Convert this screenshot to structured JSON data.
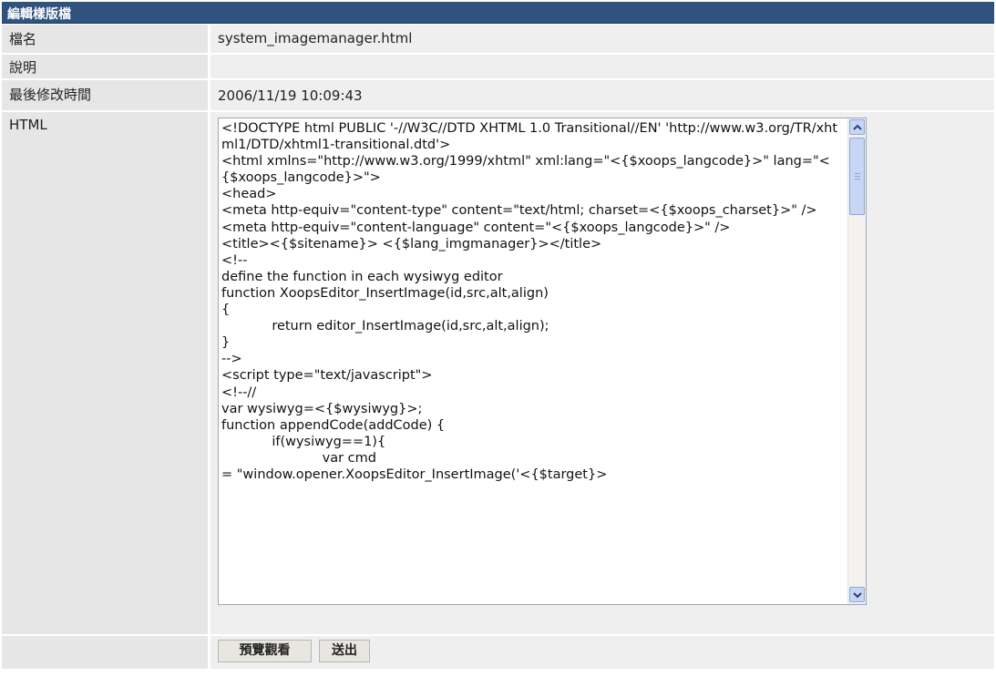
{
  "form": {
    "title": "編輯樣版檔",
    "fields": {
      "filename": {
        "label": "檔名",
        "value": "system_imagemanager.html"
      },
      "description": {
        "label": "說明",
        "value": ""
      },
      "modified": {
        "label": "最後修改時間",
        "value": "2006/11/19 10:09:43"
      },
      "html": {
        "label": "HTML",
        "content": "<!DOCTYPE html PUBLIC '-//W3C//DTD XHTML 1.0 Transitional//EN' 'http://www.w3.org/TR/xhtml1/DTD/xhtml1-transitional.dtd'>\n<html xmlns=\"http://www.w3.org/1999/xhtml\" xml:lang=\"<{$xoops_langcode}>\" lang=\"<{$xoops_langcode}>\">\n<head>\n<meta http-equiv=\"content-type\" content=\"text/html; charset=<{$xoops_charset}>\" />\n<meta http-equiv=\"content-language\" content=\"<{$xoops_langcode}>\" />\n<title><{$sitename}> <{$lang_imgmanager}></title>\n<!--\ndefine the function in each wysiwyg editor\nfunction XoopsEditor_InsertImage(id,src,alt,align)\n{\n            return editor_InsertImage(id,src,alt,align);\n}\n-->\n<script type=\"text/javascript\">\n<!--//\nvar wysiwyg=<{$wysiwyg}>;\nfunction appendCode(addCode) {\n            if(wysiwyg==1){\n                        var cmd\n= \"window.opener.XoopsEditor_InsertImage('<{$target}>"
      }
    },
    "buttons": {
      "preview": "預覽觀看",
      "submit": "送出"
    }
  }
}
